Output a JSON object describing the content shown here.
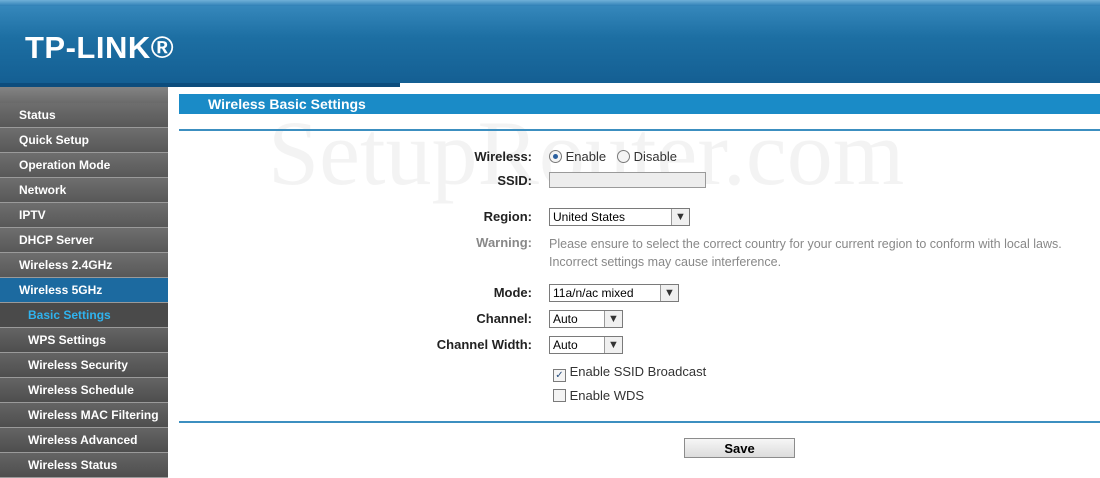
{
  "header": {
    "logo": "TP-LINK®"
  },
  "sidebar": {
    "items": [
      {
        "label": "Status"
      },
      {
        "label": "Quick Setup"
      },
      {
        "label": "Operation Mode"
      },
      {
        "label": "Network"
      },
      {
        "label": "IPTV"
      },
      {
        "label": "DHCP Server"
      },
      {
        "label": "Wireless 2.4GHz"
      },
      {
        "label": "Wireless 5GHz"
      },
      {
        "label": "Basic Settings"
      },
      {
        "label": "WPS Settings"
      },
      {
        "label": "Wireless Security"
      },
      {
        "label": "Wireless Schedule"
      },
      {
        "label": "Wireless MAC Filtering"
      },
      {
        "label": "Wireless Advanced"
      },
      {
        "label": "Wireless Status"
      }
    ]
  },
  "main": {
    "title": "Wireless Basic Settings",
    "watermark": "SetupRouter.com",
    "wireless": {
      "label": "Wireless:",
      "enable": "Enable",
      "disable": "Disable"
    },
    "ssid": {
      "label": "SSID:",
      "value": ""
    },
    "region": {
      "label": "Region:",
      "value": "United States"
    },
    "warning": {
      "label": "Warning:",
      "line1": "Please ensure to select the correct country for your current region to conform with local laws.",
      "line2": "Incorrect settings may cause interference."
    },
    "mode": {
      "label": "Mode:",
      "value": "11a/n/ac mixed"
    },
    "channel": {
      "label": "Channel:",
      "value": "Auto"
    },
    "channel_width": {
      "label": "Channel Width:",
      "value": "Auto"
    },
    "ssid_broadcast": {
      "label": "Enable SSID Broadcast",
      "checked": true
    },
    "wds": {
      "label": "Enable WDS",
      "checked": false
    },
    "save_label": "Save"
  },
  "colors": {
    "header_blue": "#1d6fa3",
    "title_bar": "#1a8bc7",
    "sidebar_gray": "#5c5c5c",
    "sidebar_active": "#1c6aa0",
    "submenu_selected_text": "#2fb3ef"
  }
}
